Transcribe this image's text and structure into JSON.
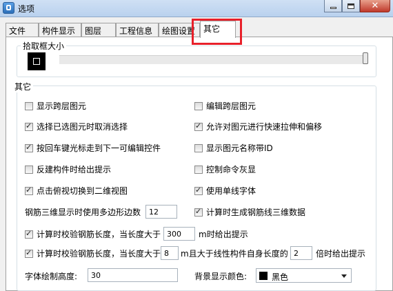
{
  "window": {
    "title": "选项"
  },
  "tabs": [
    "文件",
    "构件显示",
    "图层",
    "工程信息",
    "绘图设置",
    "其它"
  ],
  "pickbox": {
    "title": "拾取框大小"
  },
  "other": {
    "title": "其它"
  },
  "checkboxes": [
    {
      "label": "显示跨层图元",
      "checked": false
    },
    {
      "label": "编辑跨层图元",
      "checked": false
    },
    {
      "label": "选择已选图元时取消选择",
      "checked": true
    },
    {
      "label": "允许对图元进行快速拉伸和偏移",
      "checked": true
    },
    {
      "label": "按回车键光标走到下一可编辑控件",
      "checked": true
    },
    {
      "label": "显示图元名称带ID",
      "checked": false
    },
    {
      "label": "反建构件时给出提示",
      "checked": false
    },
    {
      "label": "控制命令灰显",
      "checked": false
    },
    {
      "label": "点击俯视切换到二维视图",
      "checked": true
    },
    {
      "label": "使用单线字体",
      "checked": true
    },
    {
      "label": "计算时生成钢筋线三维数据",
      "checked": true
    }
  ],
  "rebar3d": {
    "label": "钢筋三维显示时使用多边形边数",
    "value": "12"
  },
  "calc1": {
    "label": "计算时校验钢筋长度，当长度大于",
    "checked": true,
    "value": "300",
    "suffix": "m时给出提示"
  },
  "calc2": {
    "label": "计算时校验钢筋长度，当长度大于",
    "checked": true,
    "value": "8",
    "mid": "m且大于线性构件自身长度的",
    "value2": "2",
    "suffix": "倍时给出提示"
  },
  "fontheight": {
    "label": "字体绘制高度:",
    "value": "30"
  },
  "bgcolor": {
    "label": "背景显示颜色:",
    "value": "黑色",
    "color": "#000000"
  }
}
